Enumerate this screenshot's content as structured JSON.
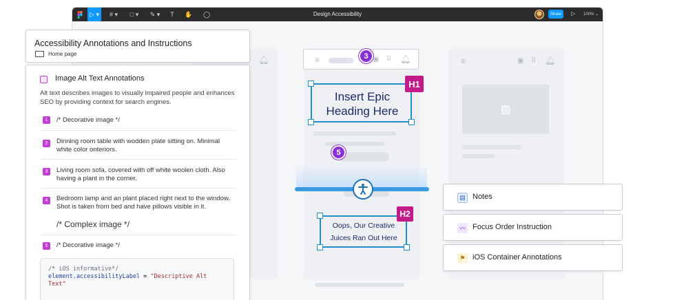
{
  "window": {
    "doc_title": "Design Accessibility",
    "share_label": "Share",
    "zoom": "100% ⌄"
  },
  "toolbar": {
    "tools": [
      "▷ ▾",
      "# ▾",
      "□ ▾",
      "✎ ▾",
      "T",
      "✋",
      "◯"
    ]
  },
  "annotations_header": {
    "title": "Accessibility Annotations and Instructions",
    "page": "Home page"
  },
  "alt_text": {
    "title": "Image Alt Text Annotations",
    "description": "Alt text describes images to visually impaired people and enhances SEO by providing context for search engines.",
    "items": [
      {
        "num": "1",
        "text": "/* Decorative image */"
      },
      {
        "num": "2",
        "text": "Dinning room table with wodden plate sitting on. Minimal white color onteriors."
      },
      {
        "num": "3",
        "text": "Living room sofa, covered with off white woolen cloth. Also having a plant in the corner."
      },
      {
        "num": "4",
        "text": "Bedroom lamp and an plant placed right next to the window. Shot is taken from bed and have pillows visible in it.",
        "note": "/* Complex image */"
      },
      {
        "num": "5",
        "text": "/* Decorative image */"
      }
    ],
    "code_comment": "/* iOS informative*/",
    "code_prop": "element.accessibilityLabel",
    "code_eq": " = ",
    "code_str": "\"Descriptive Alt Text\""
  },
  "center_phone": {
    "badge_top": "3",
    "badge_mid": "5",
    "h1_tag": "H1",
    "h1_text": "Insert Epic Heading Here",
    "h2_tag": "H2",
    "h2_text": "Oops, Our Creative Juices Ran Out Here",
    "a11y_icon": "accessibility-icon"
  },
  "right_buttons": [
    {
      "label": "Notes",
      "icon": "notes-icon"
    },
    {
      "label": "Focus Order Instruction",
      "icon": "trend-icon"
    },
    {
      "label": "iOS Container Annotations",
      "icon": "flag-icon"
    }
  ],
  "colors": {
    "accent": "#c43bd8",
    "heading_tag": "#c51b8a",
    "focus_badge": "#8b2fd6",
    "selection": "#1f8fc9",
    "figma_blue": "#0d99ff"
  }
}
